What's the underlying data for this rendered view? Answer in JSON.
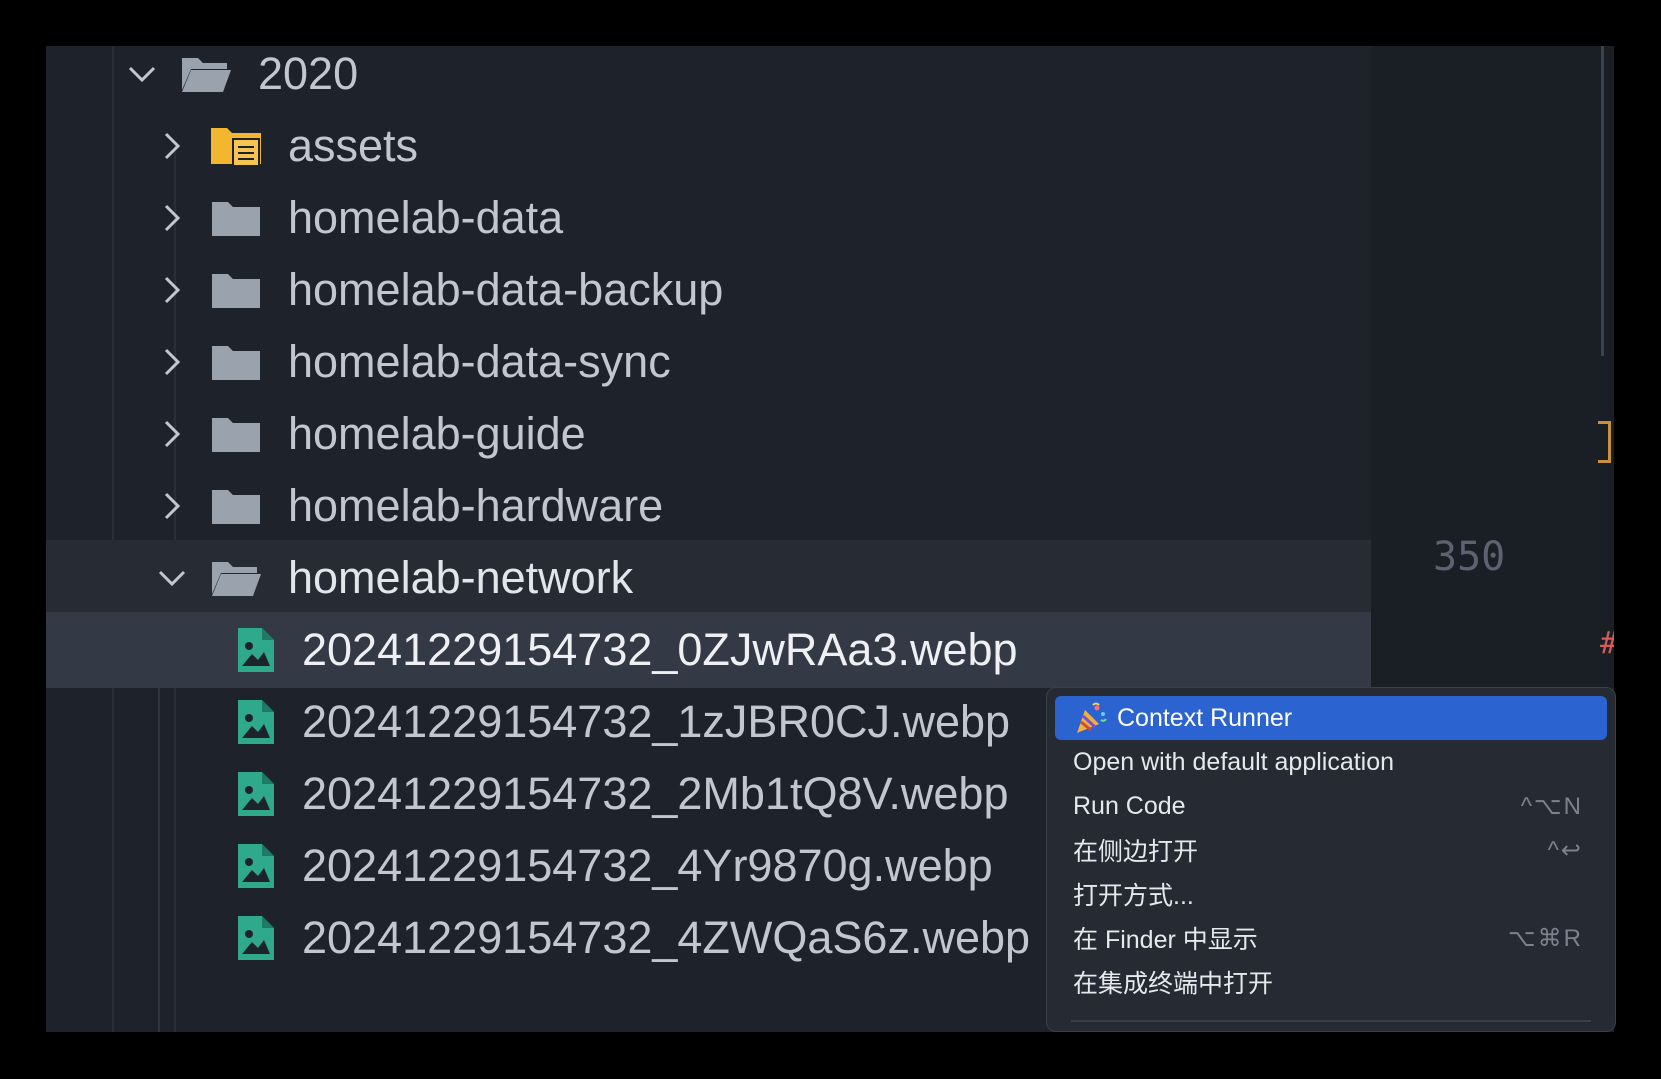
{
  "tree": {
    "root": {
      "label": "2020",
      "expanded": true
    },
    "folders": [
      {
        "label": "assets",
        "icon": "assets-folder-icon",
        "color": "#f2b630"
      },
      {
        "label": "homelab-data",
        "icon": "folder-icon"
      },
      {
        "label": "homelab-data-backup",
        "icon": "folder-icon"
      },
      {
        "label": "homelab-data-sync",
        "icon": "folder-icon"
      },
      {
        "label": "homelab-guide",
        "icon": "folder-icon"
      },
      {
        "label": "homelab-hardware",
        "icon": "folder-icon"
      }
    ],
    "open_folder": {
      "label": "homelab-network",
      "expanded": true
    },
    "files": [
      {
        "label": "20241229154732_0ZJwRAa3.webp",
        "icon": "image-file-icon"
      },
      {
        "label": "20241229154732_1zJBR0CJ.webp",
        "icon": "image-file-icon"
      },
      {
        "label": "20241229154732_2Mb1tQ8V.webp",
        "icon": "image-file-icon"
      },
      {
        "label": "20241229154732_4Yr9870g.webp",
        "icon": "image-file-icon"
      },
      {
        "label": "20241229154732_4ZWQaS6z.webp",
        "icon": "image-file-icon"
      }
    ]
  },
  "editor": {
    "line_number": "350"
  },
  "context_menu": {
    "items": [
      {
        "label": "Context Runner",
        "icon": "party-popper-icon",
        "shortcut": ""
      },
      {
        "label": "Open with default application",
        "shortcut": ""
      },
      {
        "label": "Run Code",
        "shortcut": "^⌥N"
      },
      {
        "label": "在侧边打开",
        "shortcut": "^↩"
      },
      {
        "label": "打开方式...",
        "shortcut": ""
      },
      {
        "label": "在 Finder 中显示",
        "shortcut": "⌥⌘R"
      },
      {
        "label": "在集成终端中打开",
        "shortcut": ""
      }
    ]
  },
  "colors": {
    "accent": "#2b63d1",
    "image_icon": "#2fa98c",
    "folder": "#9aa3ad",
    "assets_folder": "#f2b630"
  }
}
